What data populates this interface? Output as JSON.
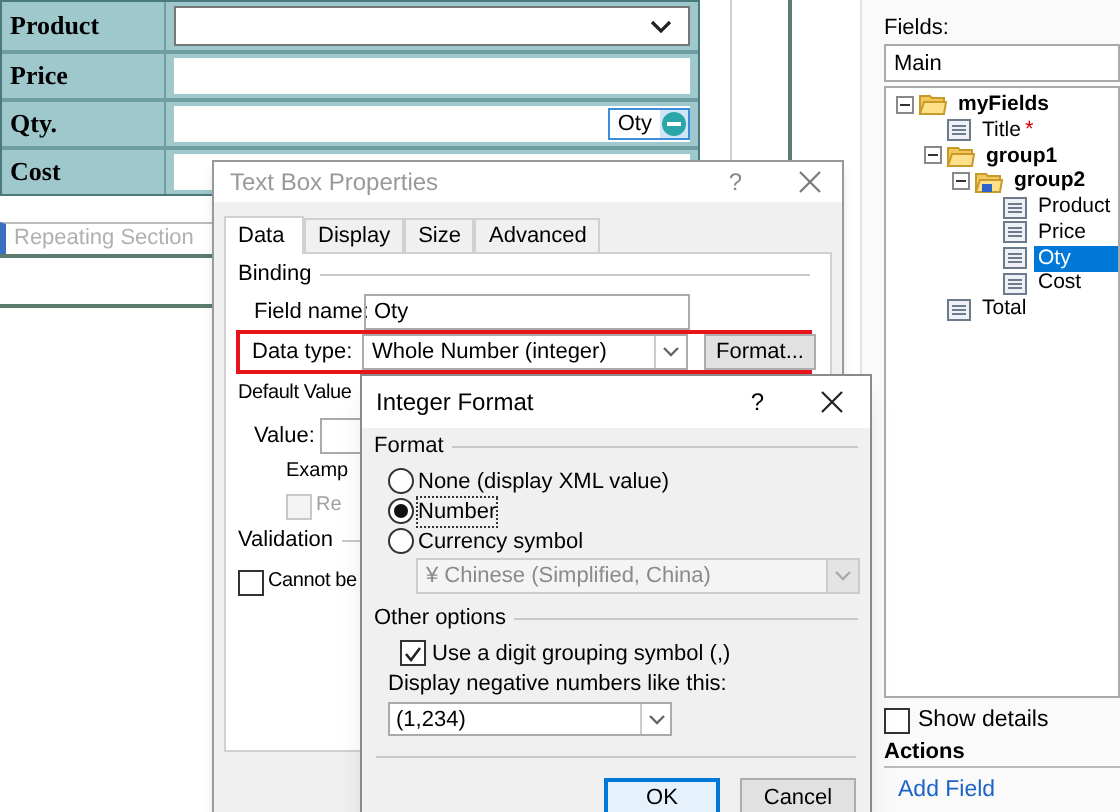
{
  "form": {
    "rows": [
      {
        "label": "Product",
        "kind": "dropdown"
      },
      {
        "label": "Price",
        "kind": "text"
      },
      {
        "label": "Qty.",
        "kind": "text",
        "tag": "Oty"
      },
      {
        "label": "Cost",
        "kind": "text"
      }
    ],
    "section_tab": "Repeating Section"
  },
  "text_box_dialog": {
    "title": "Text Box Properties",
    "help": "?",
    "tabs": [
      {
        "label": "Data",
        "selected": true
      },
      {
        "label": "Display",
        "selected": false
      },
      {
        "label": "Size",
        "selected": false
      },
      {
        "label": "Advanced",
        "selected": false
      }
    ],
    "binding": {
      "heading": "Binding",
      "field_name_label": "Field name:",
      "field_name": "Oty",
      "data_type_label": "Data type:",
      "data_type": "Whole Number (integer)",
      "format_button": "Format..."
    },
    "default_value": {
      "heading": "Default Value",
      "value_label": "Value:",
      "example": "Examp",
      "recalc": {
        "label": "Re",
        "checked": false,
        "disabled": true
      }
    },
    "validation": {
      "heading": "Validation",
      "cannot_be_blank": {
        "label": "Cannot be",
        "checked": false
      }
    }
  },
  "integer_format_dialog": {
    "title": "Integer Format",
    "help": "?",
    "format_heading": "Format",
    "options": [
      {
        "label": "None (display XML value)",
        "selected": false
      },
      {
        "label": "Number",
        "selected": true
      },
      {
        "label": "Currency symbol",
        "selected": false
      }
    ],
    "currency": {
      "value": "¥ Chinese (Simplified, China)",
      "disabled": true
    },
    "other_heading": "Other options",
    "grouping": {
      "label": "Use a digit grouping symbol (,)",
      "checked": true
    },
    "negative_label": "Display negative numbers like this:",
    "negative_value": "(1,234)",
    "buttons": [
      "OK",
      "Cancel"
    ]
  },
  "fields_panel": {
    "label": "Fields:",
    "source": "Main",
    "tree": [
      {
        "label": "myFields",
        "kind": "folder",
        "expanded": true,
        "selected": false,
        "children": [
          {
            "label": "Title",
            "kind": "field",
            "selected": false,
            "marker": "*"
          },
          {
            "label": "group1",
            "kind": "folder",
            "expanded": true,
            "selected": false,
            "children": [
              {
                "label": "group2",
                "kind": "repeating",
                "expanded": true,
                "selected": false,
                "children": [
                  {
                    "label": "Product",
                    "kind": "field",
                    "selected": false
                  },
                  {
                    "label": "Price",
                    "kind": "field",
                    "selected": false
                  },
                  {
                    "label": "Oty",
                    "kind": "field",
                    "selected": true
                  },
                  {
                    "label": "Cost",
                    "kind": "field",
                    "selected": false
                  }
                ]
              }
            ]
          },
          {
            "label": "Total",
            "kind": "field",
            "selected": false
          }
        ]
      }
    ],
    "show_details": {
      "label": "Show details",
      "checked": false
    },
    "actions_heading": "Actions",
    "actions": [
      "Add Field"
    ]
  }
}
